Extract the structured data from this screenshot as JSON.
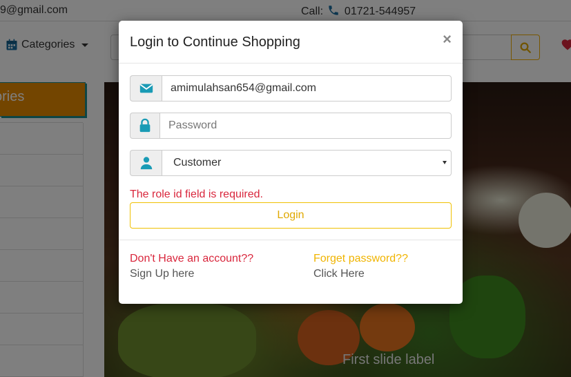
{
  "topbar": {
    "email": "9@gmail.com",
    "call_label": "Call:",
    "phone": "01721-544957"
  },
  "header": {
    "categories_label": "Categories"
  },
  "sidebar": {
    "title": "ories"
  },
  "slider": {
    "caption": "First slide label"
  },
  "modal": {
    "title": "Login to Continue Shopping",
    "close": "×",
    "email_value": "amimulahsan654@gmail.com",
    "password_placeholder": "Password",
    "role_selected": "Customer",
    "error": "The role id field is required.",
    "login_label": "Login",
    "signup_question": "Don't Have an account??",
    "signup_link": "Sign Up here",
    "forgot_question": "Forget password??",
    "forgot_link": "Click Here"
  },
  "colors": {
    "accent_orange": "#e68a00",
    "error_red": "#d9263c",
    "login_yellow": "#e0a800",
    "icon_teal": "#1a9bb5"
  }
}
